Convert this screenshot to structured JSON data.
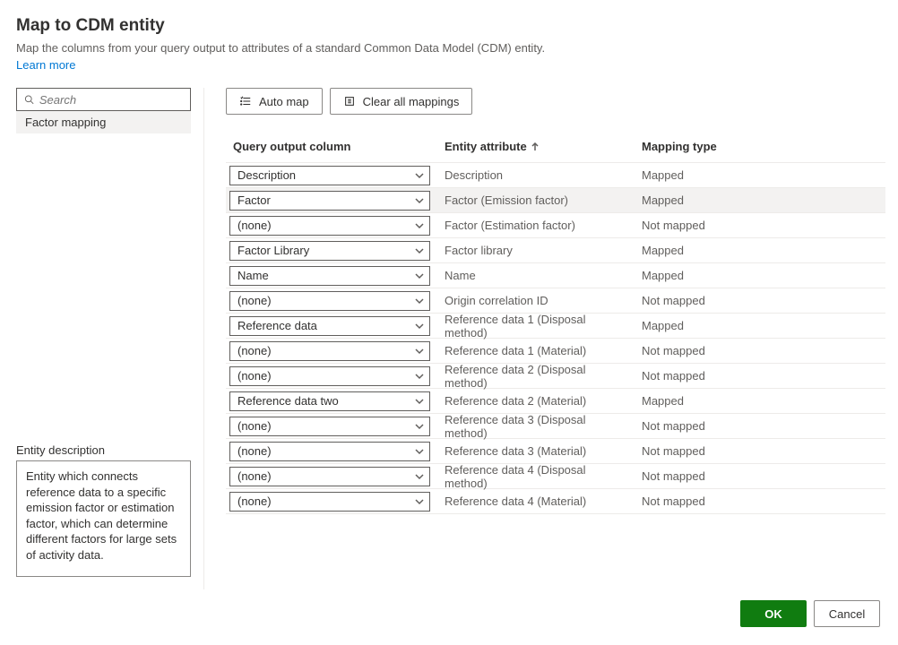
{
  "header": {
    "title": "Map to CDM entity",
    "subtitle": "Map the columns from your query output to attributes of a standard Common Data Model (CDM) entity.",
    "learn_more": "Learn more"
  },
  "sidebar": {
    "search_placeholder": "Search",
    "entity_item": "Factor mapping",
    "desc_label": "Entity description",
    "desc_text": "Entity which connects reference data to a specific emission factor or estimation factor, which can determine different factors for large sets of activity data."
  },
  "toolbar": {
    "auto_map": "Auto map",
    "clear_all": "Clear all mappings"
  },
  "columns": {
    "output": "Query output column",
    "attr": "Entity attribute",
    "type": "Mapping type"
  },
  "rows": [
    {
      "output": "Description",
      "attr": "Description",
      "type": "Mapped",
      "hl": false
    },
    {
      "output": "Factor",
      "attr": "Factor (Emission factor)",
      "type": "Mapped",
      "hl": true
    },
    {
      "output": "(none)",
      "attr": "Factor (Estimation factor)",
      "type": "Not mapped",
      "hl": false
    },
    {
      "output": "Factor Library",
      "attr": "Factor library",
      "type": "Mapped",
      "hl": false
    },
    {
      "output": "Name",
      "attr": "Name",
      "type": "Mapped",
      "hl": false
    },
    {
      "output": "(none)",
      "attr": "Origin correlation ID",
      "type": "Not mapped",
      "hl": false
    },
    {
      "output": "Reference data",
      "attr": "Reference data 1 (Disposal method)",
      "type": "Mapped",
      "hl": false
    },
    {
      "output": "(none)",
      "attr": "Reference data 1 (Material)",
      "type": "Not mapped",
      "hl": false
    },
    {
      "output": "(none)",
      "attr": "Reference data 2 (Disposal method)",
      "type": "Not mapped",
      "hl": false
    },
    {
      "output": "Reference data two",
      "attr": "Reference data 2 (Material)",
      "type": "Mapped",
      "hl": false
    },
    {
      "output": "(none)",
      "attr": "Reference data 3 (Disposal method)",
      "type": "Not mapped",
      "hl": false
    },
    {
      "output": "(none)",
      "attr": "Reference data 3 (Material)",
      "type": "Not mapped",
      "hl": false
    },
    {
      "output": "(none)",
      "attr": "Reference data 4 (Disposal method)",
      "type": "Not mapped",
      "hl": false
    },
    {
      "output": "(none)",
      "attr": "Reference data 4 (Material)",
      "type": "Not mapped",
      "hl": false
    }
  ],
  "footer": {
    "ok": "OK",
    "cancel": "Cancel"
  }
}
